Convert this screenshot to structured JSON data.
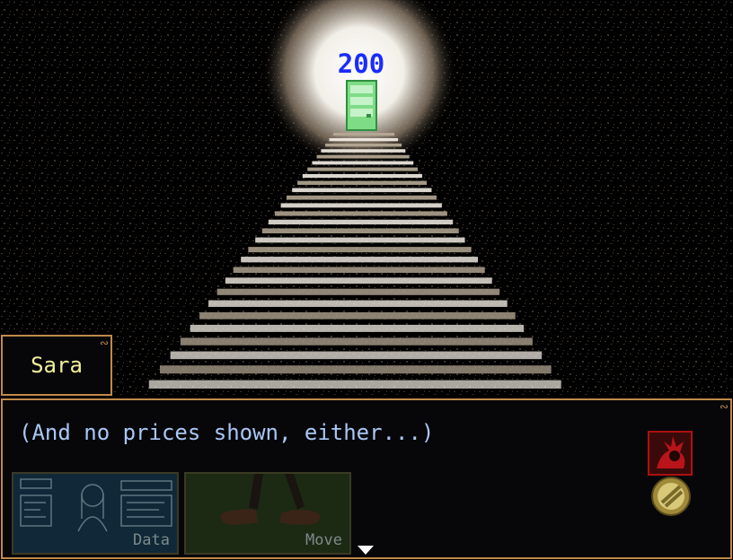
{
  "scene": {
    "counter": "200",
    "door_icon": "green-door-icon",
    "colors": {
      "light": "#ffffff",
      "stone": "#8a7a68",
      "door": "#7fdc86",
      "counter": "#1a2cff"
    }
  },
  "speaker": {
    "name": "Sara"
  },
  "dialogue": {
    "text": "(And no prices shown, either...)"
  },
  "buttons": [
    {
      "label": "Data",
      "icon": "data-icon"
    },
    {
      "label": "Move",
      "icon": "walking-feet-icon"
    }
  ],
  "side_icons": [
    "red-character-icon",
    "gold-coin-icon"
  ],
  "advance_icon": "advance-arrow-icon",
  "colors": {
    "frame": "#c08a4a",
    "name": "#f2ee9c",
    "dialogue": "#a9c7f5"
  }
}
